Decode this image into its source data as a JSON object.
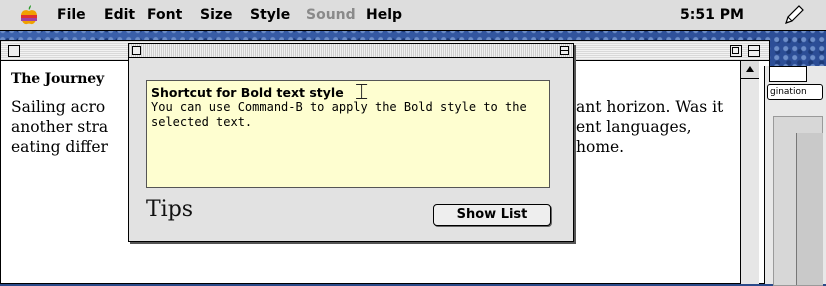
{
  "menubar": {
    "items": [
      "File",
      "Edit",
      "Font",
      "Size",
      "Style",
      "Sound",
      "Help"
    ],
    "disabled_item": "Sound",
    "clock": "5:51 PM",
    "apple_icon": "apple-icon",
    "app_icon": "pen-tool-icon"
  },
  "document": {
    "heading": "The Journey",
    "body": "Sailing across the ocean, we watched the distant horizon. Was it another strange land? We heard different languages, eating different foods, far away from home.",
    "body_line1_left": "Sailing acro",
    "body_line1_right": "ant horizon. Was it",
    "body_line2_left": "another stra",
    "body_line2_right": "ent languages,",
    "body_line3_left": "eating differ",
    "body_line3_right": "home."
  },
  "tips": {
    "tip_title": "Shortcut for Bold text style",
    "tip_text": "You can use Command-B to apply the Bold style to the selected text.",
    "label": "Tips",
    "show_list_button": "Show List"
  },
  "right_window": {
    "button_text": "gination"
  },
  "colors": {
    "desktop": "#3d63ad",
    "menubar": "#dddddd",
    "tip_background": "#fefed0",
    "disabled_menu": "#8a8a8a"
  }
}
